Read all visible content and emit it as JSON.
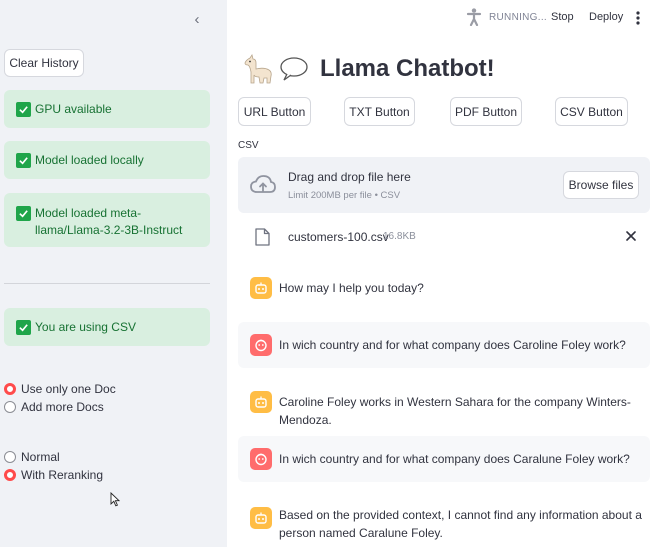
{
  "sidebar": {
    "clear_history": "Clear History",
    "status": [
      "GPU available",
      "Model loaded locally",
      "Model loaded meta-llama/Llama-3.2-3B-Instruct",
      "You are using CSV"
    ],
    "doc_mode": {
      "options": [
        "Use only one Doc",
        "Add more Docs"
      ],
      "selected": "Use only one Doc"
    },
    "rerank_mode": {
      "options": [
        "Normal",
        "With Reranking"
      ],
      "selected": "With Reranking"
    }
  },
  "topbar": {
    "running": "RUNNING...",
    "stop": "Stop",
    "deploy": "Deploy"
  },
  "main": {
    "title": "Llama Chatbot!",
    "buttons": [
      "URL Button",
      "TXT Button",
      "PDF Button",
      "CSV Button"
    ],
    "uploader": {
      "label": "CSV",
      "drag_text": "Drag and drop file here",
      "limit_text": "Limit 200MB per file • CSV",
      "browse": "Browse files"
    },
    "file": {
      "name": "customers-100.csv",
      "size": "16.8KB"
    },
    "messages": [
      {
        "role": "assistant",
        "text": "How may I help you today?"
      },
      {
        "role": "user",
        "text": "In wich country and for what company does Caroline Foley work?"
      },
      {
        "role": "assistant",
        "text": "Caroline Foley works in Western Sahara for the company Winters-Mendoza."
      },
      {
        "role": "user",
        "text": "In wich country and for what company does Caralune Foley work?"
      },
      {
        "role": "assistant",
        "text": "Based on the provided context, I cannot find any information about a person named Caralune Foley."
      }
    ]
  },
  "colors": {
    "accent": "#ff4b4b",
    "success_bg": "#d9efe0",
    "success_text": "#177233",
    "bot_avatar": "#ffbd45",
    "user_avatar": "#ff6c6c"
  },
  "icons": {
    "collapse": "chevron-left-icon",
    "running": "running-person-icon",
    "menu": "kebab-menu-icon",
    "title_emoji": [
      "llama-emoji",
      "speech-bubble-emoji"
    ],
    "upload": "cloud-upload-icon",
    "file": "file-icon",
    "remove": "close-icon",
    "check": "checkbox-checked-icon"
  }
}
